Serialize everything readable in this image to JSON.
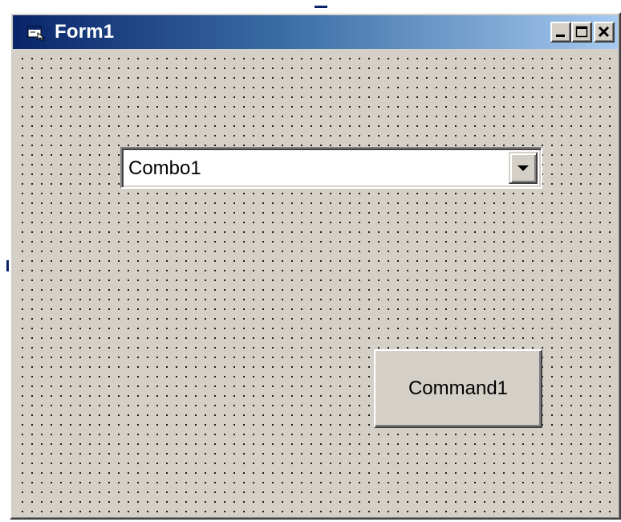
{
  "window": {
    "title": "Form1",
    "icon": "form-icon"
  },
  "titlebar_buttons": [
    {
      "name": "minimize-button",
      "icon": "minimize-icon"
    },
    {
      "name": "maximize-button",
      "icon": "maximize-icon"
    },
    {
      "name": "close-button",
      "icon": "close-icon"
    }
  ],
  "combo": {
    "value": "Combo1",
    "dropdown_icon": "chevron-down-icon"
  },
  "command": {
    "label": "Command1"
  },
  "colors": {
    "title_gradient_start": "#0a246a",
    "title_gradient_end": "#a6caf0",
    "face": "#d4d0c8",
    "grid_dot": "#000000"
  }
}
